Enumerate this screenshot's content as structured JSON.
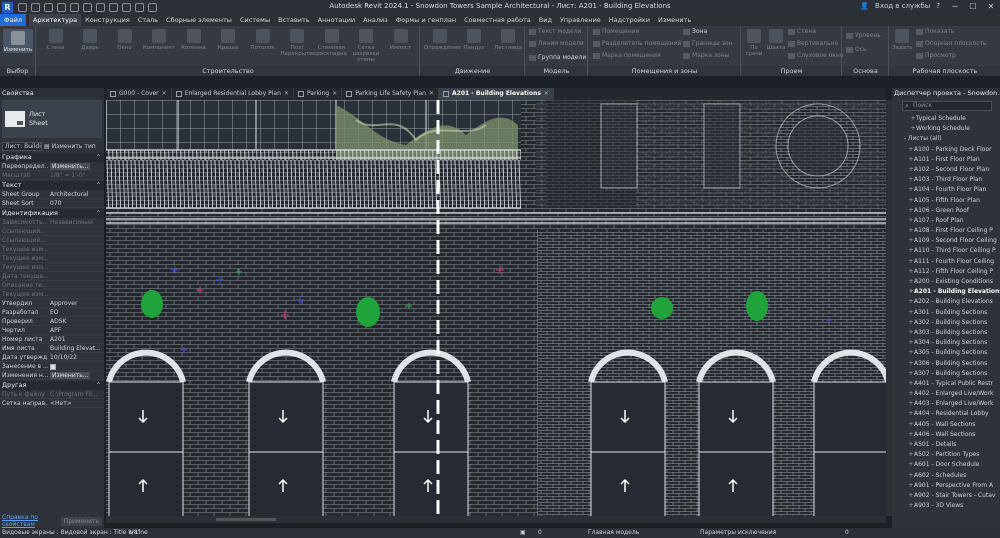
{
  "app": {
    "logo": "R",
    "title": "Autodesk Revit 2024.1 - Snowdon Towers Sample Architectural - Лист: A201 - Building Elevations",
    "user": "Вход в службы",
    "help": "?"
  },
  "menu": [
    "Файл",
    "Архитектура",
    "Конструкция",
    "Сталь",
    "Сборные элементы",
    "Системы",
    "Вставить",
    "Аннотации",
    "Анализ",
    "Формы и генплан",
    "Совместная работа",
    "Вид",
    "Управление",
    "Надстройки",
    "Изменить"
  ],
  "ribbon": {
    "select": {
      "label": "Выбор",
      "btn": "Изменить"
    },
    "build": {
      "label": "Строительство",
      "btns": [
        "Стена",
        "Дверь",
        "Окно",
        "Компонент",
        "Колонна",
        "Крыша",
        "Потолок",
        "Пол/Перекрытие",
        "Стеновая раскладка",
        "Сетка разрезки стены",
        "Импост"
      ]
    },
    "circ": {
      "label": "Движение",
      "btns": [
        "Ограждение",
        "Пандус",
        "Лестница"
      ]
    },
    "model": {
      "label": "Модель",
      "items": [
        "Текст модели",
        "Линии модели",
        "Группа модели"
      ]
    },
    "rooms": {
      "label": "Помещения и зоны",
      "items": [
        "Помещение",
        "Разделитель помещений",
        "Марка помещения",
        "Зона",
        "Границы зон",
        "Марка зоны"
      ]
    },
    "opening": {
      "label": "Проем",
      "items": [
        "По грани",
        "Шахта",
        "Стена",
        "Вертикально",
        "Слуховое окно"
      ]
    },
    "datum": {
      "label": "Основа",
      "items": [
        "Уровень",
        "Ось"
      ]
    },
    "work": {
      "label": "Рабочая плоскость",
      "items": [
        "Задать",
        "Показать",
        "Опорная плоскость",
        "Просмотр"
      ]
    }
  },
  "props": {
    "title": "Свойства",
    "type_l1": "Лист",
    "type_l2": "Sheet",
    "filter": "Лист: Buildi",
    "edit_type": "Изменить тип",
    "cat_graphics": "Графика",
    "cat_text": "Текст",
    "cat_ident": "Идентификация",
    "cat_other": "Другая",
    "rows_graphics": [
      {
        "k": "Переопредел...",
        "v": "Изменить...",
        "btn": true
      },
      {
        "k": "Масштаб",
        "v": "1/8\" = 1'-0\"",
        "dim": true
      }
    ],
    "rows_text": [
      {
        "k": "Sheet Group",
        "v": "Architectural"
      },
      {
        "k": "Sheet Sort",
        "v": "070"
      }
    ],
    "rows_ident": [
      {
        "k": "Зависимость...",
        "v": "Независимый",
        "dim": true
      },
      {
        "k": "Ссылающий...",
        "v": "",
        "dim": true
      },
      {
        "k": "Ссылающий...",
        "v": "",
        "dim": true
      },
      {
        "k": "Текущее изм...",
        "v": "",
        "dim": true
      },
      {
        "k": "Текущее изм...",
        "v": "",
        "dim": true
      },
      {
        "k": "Текущее изм...",
        "v": "",
        "dim": true
      },
      {
        "k": "Дата текуще...",
        "v": "",
        "dim": true
      },
      {
        "k": "Описание те...",
        "v": "",
        "dim": true
      },
      {
        "k": "Текущее изм...",
        "v": "",
        "dim": true
      },
      {
        "k": "Утвердил",
        "v": "Approver"
      },
      {
        "k": "Разработал",
        "v": "EO"
      },
      {
        "k": "Проверил",
        "v": "ADSK"
      },
      {
        "k": "Чертил",
        "v": "APF"
      },
      {
        "k": "Номер листа",
        "v": "A201"
      },
      {
        "k": "Имя листа",
        "v": "Building Elevat..."
      },
      {
        "k": "Дата утвержд...",
        "v": "10/10/22"
      },
      {
        "k": "Занесение в ...",
        "v": "",
        "check": true
      },
      {
        "k": "Изменения н...",
        "v": "Изменить...",
        "btn": true
      }
    ],
    "rows_other": [
      {
        "k": "Путь к файлу",
        "v": "C:\\Program Fil...",
        "dim": true
      },
      {
        "k": "Сетка направ...",
        "v": "<Нет>"
      }
    ],
    "help_link": "Справка по свойствам",
    "apply": "Применить"
  },
  "tabs": [
    {
      "label": "G000 - Cover"
    },
    {
      "label": "Enlarged Residential Lobby Plan"
    },
    {
      "label": "Parking"
    },
    {
      "label": "Parking Life Safety Plan"
    },
    {
      "label": "A201 - Building Elevations",
      "active": true
    }
  ],
  "browser": {
    "title": "Диспетчер проекта - Snowdon...",
    "search": "Поиск",
    "top": [
      {
        "t": "Typical Schedule",
        "d": "+"
      },
      {
        "t": "Working Schedule",
        "d": "+"
      },
      {
        "t": "Листы (all)",
        "d": "-"
      }
    ],
    "sheets": [
      "A100 - Parking Deck Floor",
      "A101 - First Floor Plan",
      "A102 - Second Floor Plan",
      "A103 - Third Floor Plan",
      "A104 - Fourth Floor Plan",
      "A105 - Fifth Floor Plan",
      "A106 - Green Roof",
      "A107 - Roof Plan",
      "A108 - First Floor Ceiling P",
      "A109 - Second Floor Ceiling",
      "A110 - Third Floor Ceiling P",
      "A111 - Fourth Floor Ceiling",
      "A112 - Fifth Floor Ceiling P",
      "A200 - Existing Conditions",
      "A201 - Building Elevations",
      "A202 - Building Elevations",
      "A301 - Building Sections",
      "A302 - Building Sections",
      "A303 - Building Sections",
      "A304 - Building Sections",
      "A305 - Building Sections",
      "A306 - Building Sections",
      "A307 - Building Sections",
      "A401 - Typical Public Restr",
      "A402 - Enlarged Live/Work",
      "A403 - Enlarged Live/Work",
      "A404 - Residential Lobby",
      "A405 - Wall Sections",
      "A406 - Wall Sections",
      "A501 - Details",
      "A502 - Partition Types",
      "A601 - Door Schedule",
      "A602 - Schedules",
      "A901 - Perspective From A",
      "A902 - Stair Towers - Cutav",
      "A903 - 3D Views"
    ],
    "current": "A201 - Building Elevations"
  },
  "status": {
    "left": "Видовые экраны : Видовой экран : Title w Line",
    "scale": "1/8\"",
    "model": "Главная модель",
    "excl": "Параметры исключения",
    "zero": "0"
  }
}
